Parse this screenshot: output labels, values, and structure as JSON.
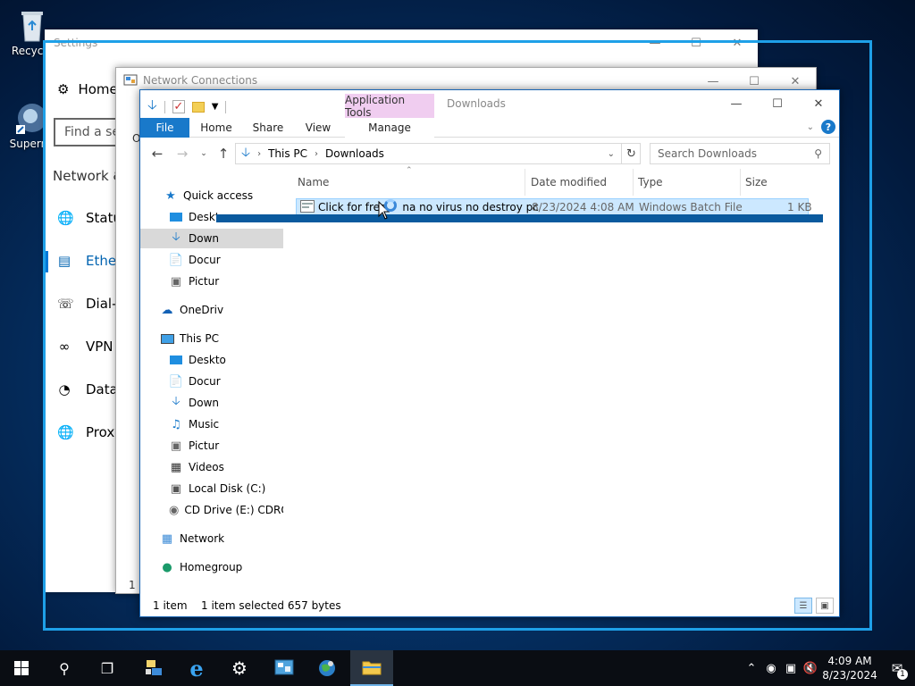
{
  "desktop": {
    "icons": [
      {
        "label": "Recycle",
        "icon": "recycle-bin-icon"
      },
      {
        "label": "Superm",
        "icon": "superman-app-icon"
      }
    ]
  },
  "settings": {
    "title": "Settings",
    "home_label": "Home",
    "find_placeholder": "Find a se",
    "section_title": "Network &",
    "nav_items": [
      {
        "label": "Statu",
        "icon": "globe-icon"
      },
      {
        "label": "Ethern",
        "icon": "ethernet-icon"
      },
      {
        "label": "Dial-u",
        "icon": "dialup-icon"
      },
      {
        "label": "VPN",
        "icon": "vpn-icon"
      },
      {
        "label": "Data",
        "icon": "data-usage-icon"
      },
      {
        "label": "Proxy",
        "icon": "globe-icon"
      }
    ]
  },
  "netconn": {
    "title": "Network Connections",
    "partial_text": "O",
    "partial_footer": "1 i"
  },
  "explorer": {
    "title": "Downloads",
    "context_tab_header": "Application Tools",
    "tabs": [
      "File",
      "Home",
      "Share",
      "View"
    ],
    "context_tab": "Manage",
    "breadcrumb": [
      "This PC",
      "Downloads"
    ],
    "search_placeholder": "Search Downloads",
    "nav_pane": {
      "quick_access": "Quick access",
      "quick_items": [
        "Deskto",
        "Down",
        "Docur",
        "Pictur"
      ],
      "onedrive": "OneDriv",
      "this_pc": "This PC",
      "pc_items": [
        "Deskto",
        "Docur",
        "Down",
        "Music",
        "Pictur",
        "Videos",
        "Local Disk (C:)",
        "CD Drive (E:) CDROI"
      ],
      "network": "Network",
      "homegroup": "Homegroup"
    },
    "columns": {
      "name": "Name",
      "date": "Date modified",
      "type": "Type",
      "size": "Size"
    },
    "files": [
      {
        "name": "Click for free",
        "name_tail": "na no virus no destroy pc",
        "date": "8/23/2024 4:08 AM",
        "type": "Windows Batch File",
        "size": "1 KB"
      }
    ],
    "status": {
      "count": "1 item",
      "selected": "1 item selected  657 bytes"
    }
  },
  "taskbar": {
    "time": "4:09 AM",
    "date": "8/23/2024",
    "notif_count": "1",
    "pinned": [
      "start",
      "search",
      "task-view",
      "network-app",
      "internet-explorer",
      "settings",
      "control-panel",
      "globe-app",
      "file-explorer"
    ]
  },
  "colors": {
    "accent": "#0078d7",
    "snap_outline": "#1ea0e8",
    "file_tab": "#1979ca",
    "context_tab": "#f0cdf0",
    "selection": "#cce8ff"
  }
}
